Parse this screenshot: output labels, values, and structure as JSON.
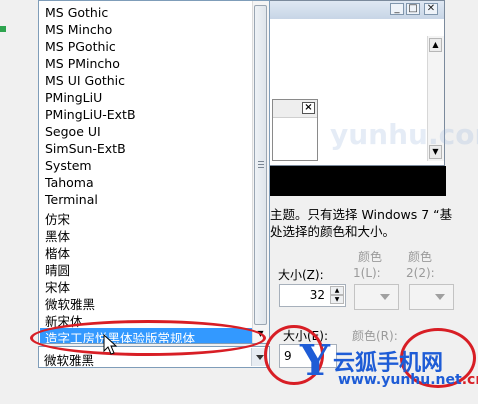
{
  "font_list": {
    "items": [
      "MS Gothic",
      "MS Mincho",
      "MS PGothic",
      "MS PMincho",
      "MS UI Gothic",
      "PMingLiU",
      "PMingLiU-ExtB",
      "Segoe UI",
      "SimSun-ExtB",
      "System",
      "Tahoma",
      "Terminal",
      "仿宋",
      "黑体",
      "楷体",
      "晴圆",
      "宋体",
      "微软雅黑",
      "新宋体"
    ],
    "selected": "造字工房悦黑体验版常规体"
  },
  "font_combo": {
    "value": "微软雅黑"
  },
  "preview": {
    "close_glyph": "✕",
    "inner_close_glyph": "×"
  },
  "description": {
    "line1": "主题。只有选择 Windows 7 “基",
    "line2": "处选择的颜色和大小。"
  },
  "item_props": {
    "size_label": "大小(Z):",
    "color1_label_a": "颜色",
    "color1_label_b": "1(L):",
    "color2_label_a": "颜色",
    "color2_label_b": "2(2):",
    "size_value": "32"
  },
  "font_props": {
    "size_label": "大小(E):",
    "color_label": "颜色(R):",
    "size_value": "9"
  },
  "watermark": {
    "logo": "Y",
    "brand": "云狐手机网",
    "url": "www.yunhu.net",
    "url_suffix": ".cn",
    "faint": "yunhu.com"
  },
  "colors": {
    "selection": "#3399ff",
    "annotation": "#d81e25",
    "watermark": "#1e5cd6"
  }
}
